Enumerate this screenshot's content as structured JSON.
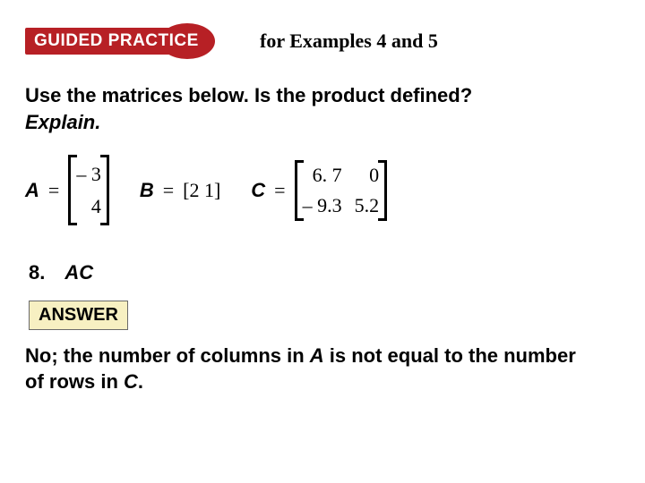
{
  "header": {
    "badge": "GUIDED PRACTICE",
    "subtitle": "for Examples 4 and 5"
  },
  "prompt": {
    "line1": "Use the matrices below. Is the product defined?",
    "line2": "Explain."
  },
  "matrices": {
    "A": {
      "label": "A",
      "eq": "=",
      "r0": "– 3",
      "r1": "4"
    },
    "B": {
      "label": "B",
      "eq": "=",
      "row": "[2  1]"
    },
    "C": {
      "label": "C",
      "eq": "=",
      "c00": "6. 7",
      "c01": "0",
      "c10": "– 9.3",
      "c11": "5.2"
    }
  },
  "question": {
    "number": "8.",
    "expr": "AC"
  },
  "answer": {
    "label": "ANSWER",
    "text_pre": "No; the number of columns in ",
    "var1": "A",
    "text_mid": " is not equal to the number of rows in ",
    "var2": "C",
    "text_post": "."
  }
}
